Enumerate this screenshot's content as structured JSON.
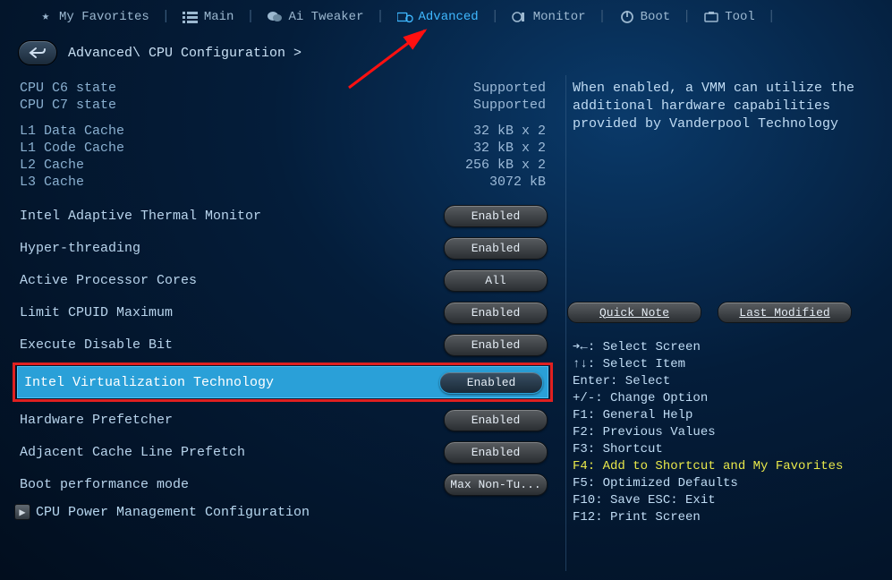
{
  "nav": {
    "favorites": "My Favorites",
    "main": "Main",
    "ai_tweaker": "Ai Tweaker",
    "advanced": "Advanced",
    "monitor": "Monitor",
    "boot": "Boot",
    "tool": "Tool"
  },
  "breadcrumb": "Advanced\\ CPU Configuration >",
  "info": {
    "c6_label": "CPU C6 state",
    "c6_value": "Supported",
    "c7_label": "CPU C7 state",
    "c7_value": "Supported",
    "l1d_label": "L1 Data Cache",
    "l1d_value": "32 kB x 2",
    "l1c_label": "L1 Code Cache",
    "l1c_value": "32 kB x 2",
    "l2_label": "L2 Cache",
    "l2_value": "256 kB x 2",
    "l3_label": "L3 Cache",
    "l3_value": "3072 kB"
  },
  "settings": [
    {
      "label": "Intel Adaptive Thermal Monitor",
      "value": "Enabled"
    },
    {
      "label": "Hyper-threading",
      "value": "Enabled"
    },
    {
      "label": "Active Processor Cores",
      "value": "All"
    },
    {
      "label": "Limit CPUID Maximum",
      "value": "Enabled"
    },
    {
      "label": "Execute Disable Bit",
      "value": "Enabled"
    },
    {
      "label": "Intel Virtualization Technology",
      "value": "Enabled"
    },
    {
      "label": "Hardware Prefetcher",
      "value": "Enabled"
    },
    {
      "label": "Adjacent Cache Line Prefetch",
      "value": "Enabled"
    },
    {
      "label": "Boot performance mode",
      "value": "Max Non-Tu..."
    }
  ],
  "submenu": {
    "label": "CPU Power Management Configuration"
  },
  "help": {
    "text": "When enabled, a VMM can utilize the additional hardware capabilities provided by Vanderpool Technology"
  },
  "quick": {
    "note": "Quick Note",
    "last": "Last Modified"
  },
  "keys": {
    "k0": "➔←: Select Screen",
    "k1": "↑↓: Select Item",
    "k2": "Enter: Select",
    "k3": "+/-: Change Option",
    "k4": "F1: General Help",
    "k5": "F2: Previous Values",
    "k6": "F3: Shortcut",
    "k7": "F4: Add to Shortcut and My Favorites",
    "k8": "F5: Optimized Defaults",
    "k9": "F10: Save  ESC: Exit",
    "k10": "F12: Print Screen"
  }
}
